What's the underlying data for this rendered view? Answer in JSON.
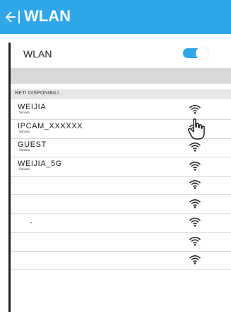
{
  "header": {
    "title": "WLAN"
  },
  "wlan": {
    "label": "WLAN",
    "enabled": true
  },
  "section": {
    "title": "RETI DISPONIBILI"
  },
  "networks": [
    {
      "name": "WEIJIA",
      "status": "Salvata"
    },
    {
      "name": "IPCAM_XXXXXX",
      "status": "Salvata"
    },
    {
      "name": "GUEST",
      "status": "Salvata"
    },
    {
      "name": "WEIJIA_5G",
      "status": "Salvata"
    },
    {
      "name": "",
      "status": ""
    },
    {
      "name": "",
      "status": ""
    },
    {
      "name": "",
      "status": ""
    },
    {
      "name": "",
      "status": ""
    },
    {
      "name": "",
      "status": ""
    }
  ],
  "colors": {
    "accent": "#2fa6e8",
    "header_text": "#ffffff"
  },
  "icons": {
    "back": "back-arrow-icon",
    "wifi": "wifi-icon",
    "pointer": "hand-pointer-icon"
  }
}
